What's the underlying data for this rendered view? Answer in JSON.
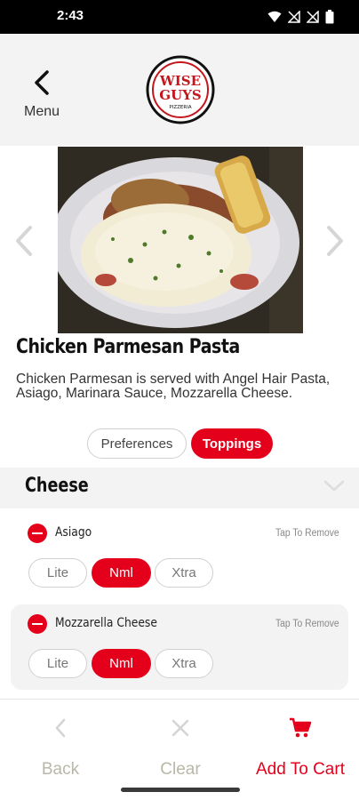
{
  "status_bar": {
    "time": "2:43"
  },
  "header": {
    "back_label": "Menu",
    "logo": {
      "line1": "WISE",
      "line2": "GUYS",
      "line3": "PIZZERIA"
    }
  },
  "item": {
    "title": "Chicken Parmesan Pasta",
    "description": "Chicken Parmesan is served with Angel Hair Pasta, Asiago, Marinara Sauce, Mozzarella Cheese."
  },
  "tabs": {
    "preferences": "Preferences",
    "toppings": "Toppings"
  },
  "section": {
    "title": "Cheese"
  },
  "toppings": [
    {
      "name": "Asiago",
      "action": "Tap To Remove",
      "amounts": [
        "Lite",
        "Nml",
        "Xtra"
      ],
      "selected": "Nml"
    },
    {
      "name": "Mozzarella Cheese",
      "action": "Tap To Remove",
      "amounts": [
        "Lite",
        "Nml",
        "Xtra"
      ],
      "selected": "Nml"
    }
  ],
  "footer": {
    "back": "Back",
    "clear": "Clear",
    "add_to_cart": "Add To Cart"
  },
  "colors": {
    "accent": "#e4001b",
    "muted": "#b9b7a6",
    "header_bg": "#f3f3f3"
  }
}
